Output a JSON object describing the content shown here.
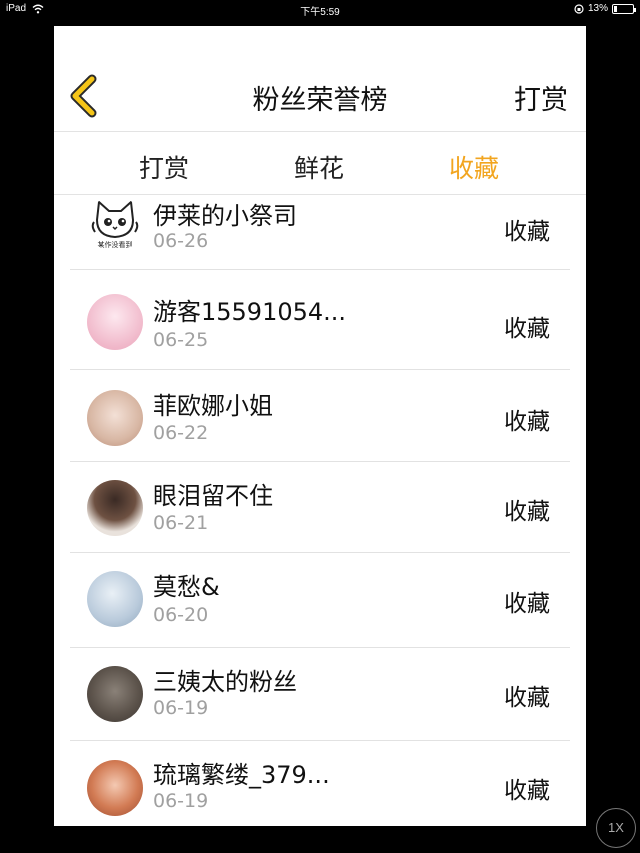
{
  "status_bar": {
    "device": "iPad",
    "time": "下午5:59",
    "battery_text": "13%",
    "battery_level": 0.13
  },
  "nav": {
    "title": "粉丝荣誉榜",
    "action": "打赏",
    "back_icon": "chevron-left-icon",
    "accent_color": "#f2a51f"
  },
  "tabs": [
    {
      "label": "打赏",
      "active": false
    },
    {
      "label": "鲜花",
      "active": false
    },
    {
      "label": "收藏",
      "active": true
    }
  ],
  "rows": [
    {
      "name": "伊莱的小祭司",
      "date": "06-26",
      "action": "收藏",
      "avatar_caption": "某作没看到"
    },
    {
      "name": "游客15591054...",
      "date": "06-25",
      "action": "收藏"
    },
    {
      "name": "菲欧娜小姐",
      "date": "06-22",
      "action": "收藏"
    },
    {
      "name": "眼泪留不住",
      "date": "06-21",
      "action": "收藏"
    },
    {
      "name": "莫愁&",
      "date": "06-20",
      "action": "收藏"
    },
    {
      "name": "三姨太的粉丝",
      "date": "06-19",
      "action": "收藏"
    },
    {
      "name": "琉璃繁缕_379...",
      "date": "06-19",
      "action": "收藏"
    }
  ],
  "overlay": {
    "speed_label": "1X"
  }
}
